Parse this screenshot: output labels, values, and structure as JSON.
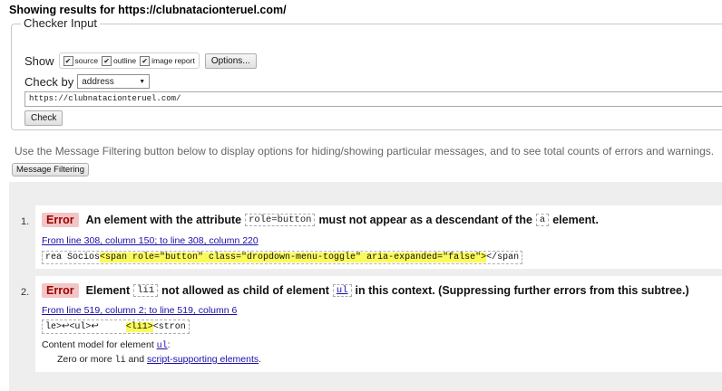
{
  "heading": "Showing results for https://clubnatacionteruel.com/",
  "checker": {
    "legend": "Checker Input",
    "show_label": "Show",
    "options": [
      {
        "label": "source",
        "checked": true
      },
      {
        "label": "outline",
        "checked": true
      },
      {
        "label": "image report",
        "checked": true
      }
    ],
    "options_button": "Options...",
    "check_by_label": "Check by",
    "check_by_value": "address",
    "url_value": "https://clubnatacionteruel.com/",
    "check_button": "Check"
  },
  "info_text": "Use the Message Filtering button below to display options for hiding/showing particular messages, and to see total counts of errors and warnings.",
  "filter_button": "Message Filtering",
  "messages": [
    {
      "number": "1.",
      "type": "Error",
      "title_parts": [
        "An element with the attribute",
        "role=button",
        "must not appear as a descendant of the",
        "a",
        "element."
      ],
      "location": "From line 308, column 150; to line 308, column 220",
      "extract_before": "rea Socios",
      "extract_highlight": "<span role=\"button\" class=\"dropdown-menu-toggle\" aria-expanded=\"false\">",
      "extract_after": "</span"
    },
    {
      "number": "2.",
      "type": "Error",
      "title_parts": [
        "Element",
        "li1",
        "not allowed as child of element",
        "ul",
        "in this context. (Suppressing further errors from this subtree.)"
      ],
      "location": "From line 519, column 2; to line 519, column 6",
      "extract_before": "le>↩<ul>↩     ",
      "extract_highlight": "<li1>",
      "extract_after": "<stron",
      "content_model_prefix": "Content model for element",
      "content_model_element": "ul",
      "content_model_suffix": ":",
      "content_model_body_prefix": "Zero or more",
      "content_model_body_code": "li",
      "content_model_body_mid": "and",
      "content_model_body_link": "script-supporting elements",
      "content_model_body_suffix": "."
    }
  ],
  "colors": {
    "error_badge_bg": "#f2c6c6",
    "error_badge_text": "#9c0000",
    "highlight": "#fafa5a",
    "link": "#1a0dab",
    "results_bg": "#eeeeee"
  }
}
